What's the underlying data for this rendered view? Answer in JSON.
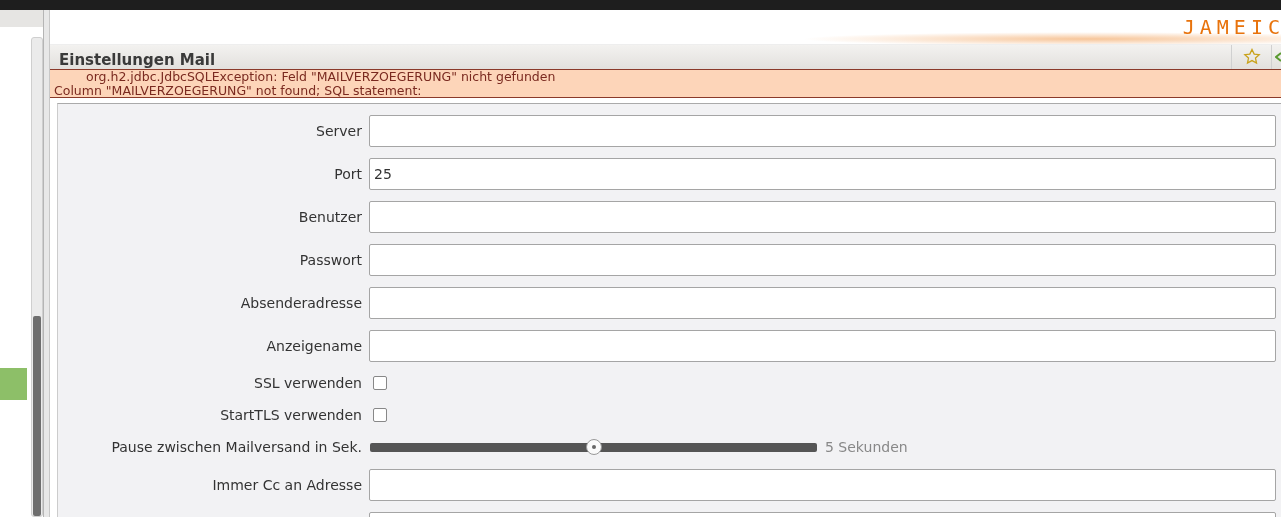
{
  "logo": "JAMEIC",
  "view": {
    "title": "Einstellungen Mail"
  },
  "error": {
    "lines": [
      "org.h2.jdbc.JdbcSQLException: Feld \"MAILVERZOEGERUNG\" nicht gefunden",
      "Column \"MAILVERZOEGERUNG\" not found; SQL statement:"
    ]
  },
  "fields": [
    {
      "kind": "text",
      "label": "Server"
    },
    {
      "kind": "text",
      "label": "Port",
      "value": "25"
    },
    {
      "kind": "text",
      "label": "Benutzer"
    },
    {
      "kind": "text",
      "label": "Passwort"
    },
    {
      "kind": "text",
      "label": "Absenderadresse"
    },
    {
      "kind": "text",
      "label": "Anzeigename"
    },
    {
      "kind": "checkbox",
      "label": "SSL verwenden",
      "checked": false
    },
    {
      "kind": "checkbox",
      "label": "StartTLS verwenden",
      "checked": false
    },
    {
      "kind": "slider",
      "label": "Pause zwischen Mailversand in Sek.",
      "level": 0.5,
      "reading": "5 Sekunden"
    },
    {
      "kind": "text",
      "label": "Immer Cc an Adresse"
    },
    {
      "kind": "text"
    }
  ]
}
